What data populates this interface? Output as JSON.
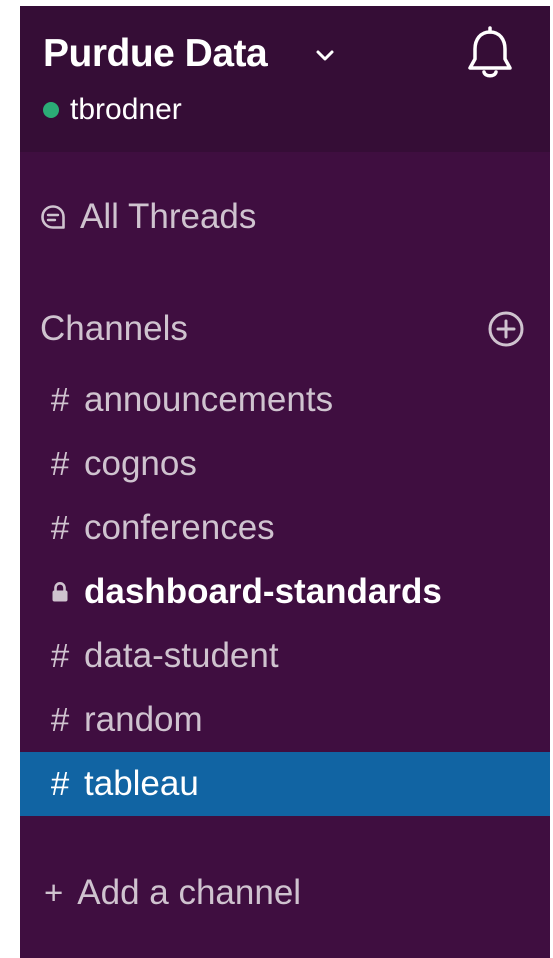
{
  "workspace": {
    "name": "Purdue Data",
    "user": "tbrodner",
    "presence_color": "#2bac76"
  },
  "theme": {
    "sidebar_bg": "#3f0e40",
    "header_bg": "#350d36",
    "active_bg": "#1164a3",
    "muted_text": "#cfc3cf"
  },
  "nav": {
    "threads_label": "All Threads",
    "threads_icon": "threads-icon"
  },
  "channels": {
    "section_title": "Channels",
    "add_icon": "add-circle-icon",
    "items": [
      {
        "prefix": "#",
        "name": "announcements",
        "style": "normal"
      },
      {
        "prefix": "#",
        "name": "cognos",
        "style": "normal"
      },
      {
        "prefix": "#",
        "name": "conferences",
        "style": "normal"
      },
      {
        "prefix": "lock",
        "name": "dashboard-standards",
        "style": "bold"
      },
      {
        "prefix": "#",
        "name": "data-student",
        "style": "normal"
      },
      {
        "prefix": "#",
        "name": "random",
        "style": "normal"
      },
      {
        "prefix": "#",
        "name": "tableau",
        "style": "active"
      }
    ],
    "add_prefix": "+",
    "add_label": "Add a channel"
  }
}
